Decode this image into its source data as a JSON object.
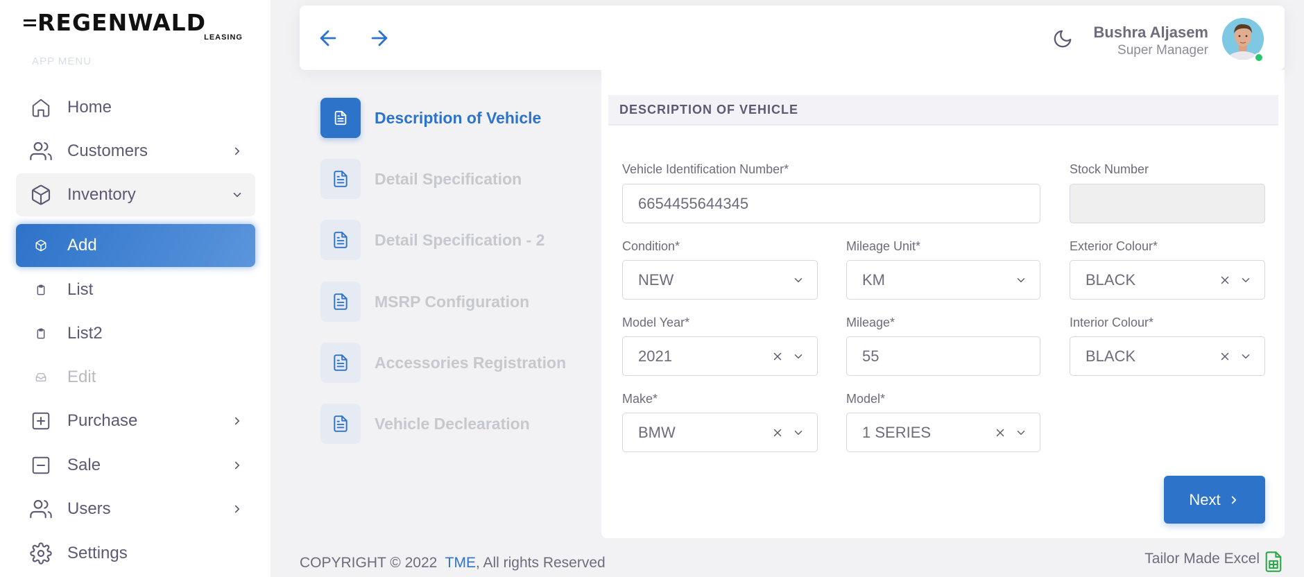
{
  "brand": {
    "name": "REGENWALD",
    "subtitle": "LEASING"
  },
  "sidebar": {
    "section_label": "APP MENU",
    "items": [
      {
        "label": "Home",
        "icon": "home-icon"
      },
      {
        "label": "Customers",
        "icon": "users-icon"
      },
      {
        "label": "Inventory",
        "icon": "box-icon"
      },
      {
        "label": "Add",
        "icon": "cube-icon"
      },
      {
        "label": "List",
        "icon": "clipboard-icon"
      },
      {
        "label": "List2",
        "icon": "clipboard-icon"
      },
      {
        "label": "Edit",
        "icon": "inbox-icon"
      },
      {
        "label": "Purchase",
        "icon": "plus-square-icon"
      },
      {
        "label": "Sale",
        "icon": "minus-square-icon"
      },
      {
        "label": "Users",
        "icon": "users-icon"
      },
      {
        "label": "Settings",
        "icon": "gear-icon"
      }
    ]
  },
  "header": {
    "user_name": "Bushra Aljasem",
    "user_role": "Super Manager"
  },
  "steps": [
    {
      "label": "Description of Vehicle"
    },
    {
      "label": "Detail Specification"
    },
    {
      "label": "Detail Specification - 2"
    },
    {
      "label": "MSRP Configuration"
    },
    {
      "label": "Accessories Registration"
    },
    {
      "label": "Vehicle Declearation"
    }
  ],
  "form": {
    "section_title": "DESCRIPTION OF VEHICLE",
    "vin": {
      "label": "Vehicle Identification Number*",
      "value": "6654455644345"
    },
    "stock_number": {
      "label": "Stock Number",
      "value": ""
    },
    "condition": {
      "label": "Condition*",
      "value": "NEW"
    },
    "mileage_unit": {
      "label": "Mileage Unit*",
      "value": "KM"
    },
    "exterior_colour": {
      "label": "Exterior Colour*",
      "value": "BLACK"
    },
    "model_year": {
      "label": "Model Year*",
      "value": "2021"
    },
    "mileage": {
      "label": "Mileage*",
      "value": "55"
    },
    "interior_colour": {
      "label": "Interior Colour*",
      "value": "BLACK"
    },
    "make": {
      "label": "Make*",
      "value": "BMW"
    },
    "model": {
      "label": "Model*",
      "value": "1 SERIES"
    },
    "next_label": "Next"
  },
  "footer": {
    "copyright": "COPYRIGHT © 2022",
    "company_link": "TME",
    "rights": ", All rights Reserved",
    "credit": "Tailor Made Excel"
  },
  "colors": {
    "primary": "#2d73c9",
    "text": "#5e5873",
    "muted": "#c6c8ce",
    "online": "#28c76f"
  }
}
